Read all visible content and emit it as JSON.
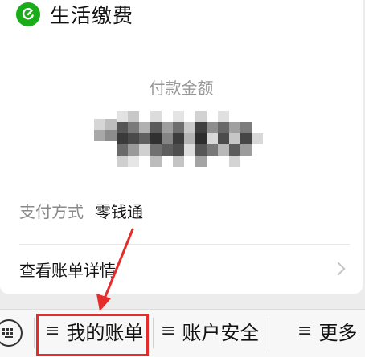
{
  "header": {
    "title": "生活缴费",
    "logo_icon": "wechat-pay-icon",
    "brand_color": "#1aad19"
  },
  "payment": {
    "amount_label": "付款金额",
    "method_label": "支付方式",
    "method_value": "零钱通"
  },
  "detail": {
    "label": "查看账单详情",
    "chevron_icon": "chevron-right-icon"
  },
  "bottom_menu": {
    "keyboard_icon": "keyboard-icon",
    "items": [
      {
        "icon": "≡",
        "label": "我的账单"
      },
      {
        "icon": "≡",
        "label": "账户安全"
      },
      {
        "icon": "≡",
        "label": "更多"
      }
    ]
  },
  "annotation": {
    "color": "#e62b2b"
  }
}
